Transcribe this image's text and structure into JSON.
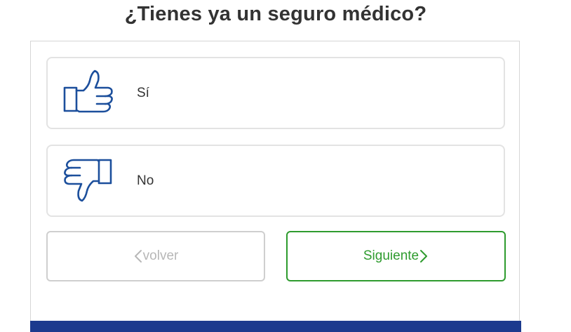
{
  "page": {
    "question": "¿Tienes ya un seguro médico?"
  },
  "options": [
    {
      "label": "Sí",
      "icon": "thumbs-up-icon"
    },
    {
      "label": "No",
      "icon": "thumbs-down-icon"
    }
  ],
  "navigation": {
    "back_label": "volver",
    "next_label": "Siguiente"
  },
  "colors": {
    "icon": "#1c4f9c",
    "next_green": "#2e9b2e",
    "back_gray": "#b7b7b7",
    "footer_bar": "#1c3a8e"
  }
}
